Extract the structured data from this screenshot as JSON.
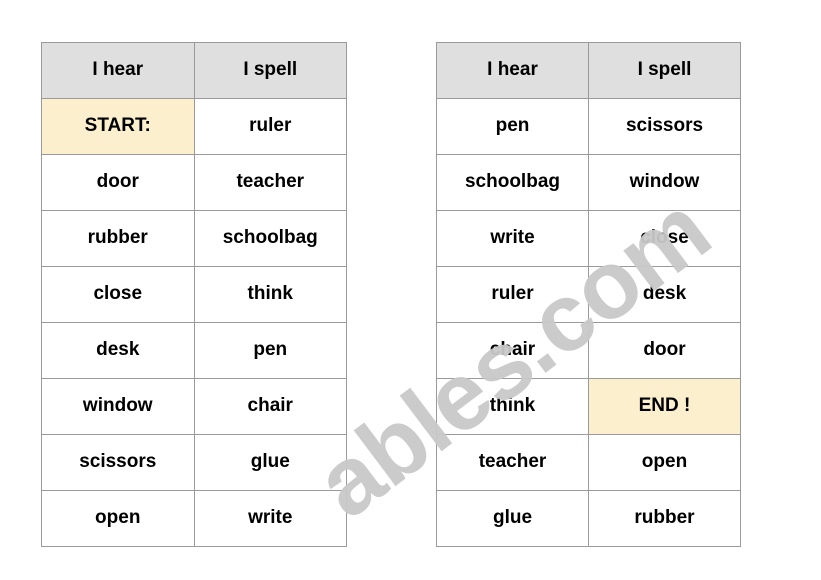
{
  "page": {
    "watermark_text": "ables.com",
    "background_color": "#ffffff",
    "header_bg_color": "#dfdfdf",
    "highlight_bg_color": "#fcefcd",
    "border_color": "#9a9a9a",
    "watermark_color": "#c9c9c9"
  },
  "tables": [
    {
      "name": "left-table",
      "headers": [
        "I hear",
        "I spell"
      ],
      "rows": [
        {
          "hear": "START:",
          "spell": "ruler",
          "hear_highlight": true,
          "spell_highlight": false
        },
        {
          "hear": "door",
          "spell": "teacher",
          "hear_highlight": false,
          "spell_highlight": false
        },
        {
          "hear": "rubber",
          "spell": "schoolbag",
          "hear_highlight": false,
          "spell_highlight": false
        },
        {
          "hear": "close",
          "spell": "think",
          "hear_highlight": false,
          "spell_highlight": false
        },
        {
          "hear": "desk",
          "spell": "pen",
          "hear_highlight": false,
          "spell_highlight": false
        },
        {
          "hear": "window",
          "spell": "chair",
          "hear_highlight": false,
          "spell_highlight": false
        },
        {
          "hear": "scissors",
          "spell": "glue",
          "hear_highlight": false,
          "spell_highlight": false
        },
        {
          "hear": "open",
          "spell": "write",
          "hear_highlight": false,
          "spell_highlight": false
        }
      ]
    },
    {
      "name": "right-table",
      "headers": [
        "I hear",
        "I spell"
      ],
      "rows": [
        {
          "hear": "pen",
          "spell": "scissors",
          "hear_highlight": false,
          "spell_highlight": false
        },
        {
          "hear": "schoolbag",
          "spell": "window",
          "hear_highlight": false,
          "spell_highlight": false
        },
        {
          "hear": "write",
          "spell": "close",
          "hear_highlight": false,
          "spell_highlight": false
        },
        {
          "hear": "ruler",
          "spell": "desk",
          "hear_highlight": false,
          "spell_highlight": false
        },
        {
          "hear": "chair",
          "spell": "door",
          "hear_highlight": false,
          "spell_highlight": false
        },
        {
          "hear": "think",
          "spell": "END !",
          "hear_highlight": false,
          "spell_highlight": true
        },
        {
          "hear": "teacher",
          "spell": "open",
          "hear_highlight": false,
          "spell_highlight": false
        },
        {
          "hear": "glue",
          "spell": "rubber",
          "hear_highlight": false,
          "spell_highlight": false
        }
      ]
    }
  ]
}
